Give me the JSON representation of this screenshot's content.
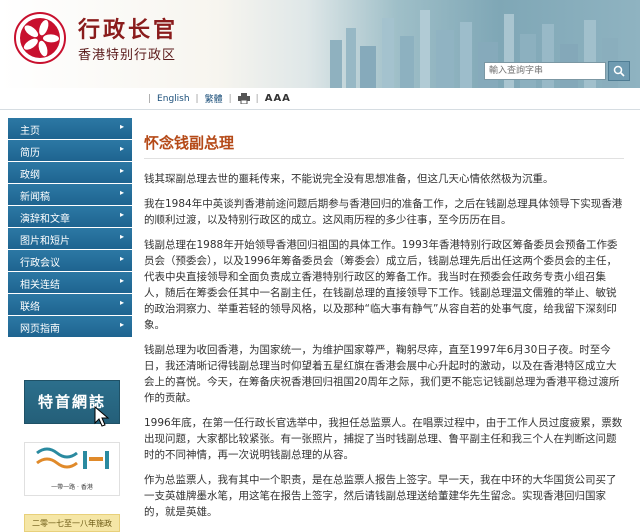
{
  "header": {
    "title": "行政长官",
    "subtitle": "香港特别行政区",
    "search_placeholder": "輸入查詢字串"
  },
  "toolbar": {
    "english": "English",
    "traditional": "繁體",
    "font_size": "AAA"
  },
  "sidebar": {
    "items": [
      {
        "label": "主页"
      },
      {
        "label": "简历"
      },
      {
        "label": "政纲"
      },
      {
        "label": "新闻稿"
      },
      {
        "label": "演辞和文章"
      },
      {
        "label": "图片和短片"
      },
      {
        "label": "行政会议"
      },
      {
        "label": "相关连结"
      },
      {
        "label": "联络"
      },
      {
        "label": "网页指南"
      }
    ],
    "banner_1": "特首網誌",
    "banner_2_caption": "一帶一路 · 香港",
    "banner_3": "二零一七至一八年施政"
  },
  "main": {
    "title": "怀念钱副总理",
    "paragraphs": [
      "钱其琛副总理去世的噩耗传来，不能说完全没有思想准备，但这几天心情依然极为沉重。",
      "我在1984年中英谈判香港前途问题后期参与香港回归的准备工作，之后在钱副总理具体领导下实现香港的顺利过渡，以及特别行政区的成立。这风雨历程的多少往事，至今历历在目。",
      "钱副总理在1988年开始领导香港回归祖国的具体工作。1993年香港特别行政区筹备委员会预备工作委员会（预委会），以及1996年筹备委员会（筹委会）成立后，钱副总理先后出任这两个委员会的主任，代表中央直接领导和全面负责成立香港特别行政区的筹备工作。我当时在预委会任政务专责小组召集人，随后在筹委会任其中一名副主任，在钱副总理的直接领导下工作。钱副总理温文儒雅的举止、敏锐的政治洞察力、举重若轻的领导风格，以及那种“临大事有静气”从容自若的处事气度，给我留下深刻印象。",
      "钱副总理为收回香港，为国家统一，为维护国家尊严，鞠躬尽瘁，直至1997年6月30日子夜。时至今日，我还清晰记得钱副总理当时仰望着五星红旗在香港会展中心升起时的激动，以及在香港特区成立大会上的喜悦。今天，在筹备庆祝香港回归祖国20周年之际，我们更不能忘记钱副总理为香港平稳过渡所作的贡献。",
      "1996年底，在第一任行政长官选举中，我担任总监票人。在唱票过程中，由于工作人员过度疲累，票数出现问题，大家都比较紧张。有一张照片，捕捉了当时钱副总理、鲁平副主任和我三个人在判断这问题时的不同神情，再一次说明钱副总理的从容。",
      "作为总监票人，我有其中一个职责，是在总监票人报告上签字。早一天，我在中环的大华国货公司买了一支英雄牌墨水笔，用这笔在报告上签字，然后请钱副总理送给董建华先生留念。实现香港回归国家的，就是英雄。"
    ]
  },
  "colors": {
    "nav_blue": "#1e6490",
    "title_orange": "#b54a18",
    "brand_red": "#8a1c1c"
  }
}
